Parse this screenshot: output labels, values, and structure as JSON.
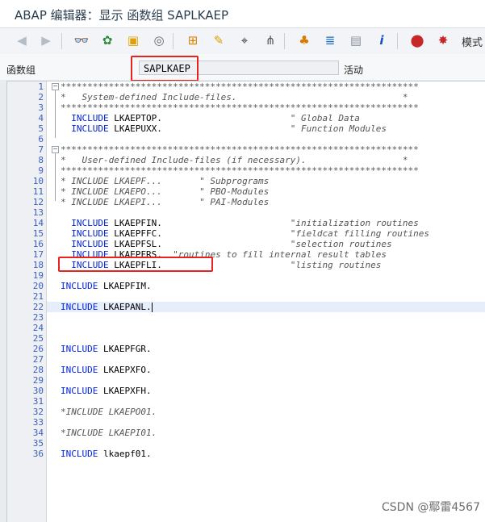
{
  "title": "ABAP 编辑器：显示 函数组 SAPLKAEP",
  "toolbar": {
    "icons": [
      "back-arrow-icon",
      "forward-arrow-icon",
      "glasses-icon",
      "object-list-icon",
      "shared-object-icon",
      "where-used-icon",
      "hierarchy-icon",
      "magic-wand-icon",
      "pattern-icon",
      "pretty-printer-icon",
      "org-chart-icon",
      "stack-icon",
      "layout-icon",
      "info-icon",
      "debug-session-icon",
      "external-breakpoint-icon"
    ],
    "mode_label": "模式"
  },
  "field": {
    "label": "函数组",
    "value": "SAPLKAEP",
    "status": "活动"
  },
  "lines": [
    {
      "n": "1",
      "t": "*******************************************************************",
      "c": "cm",
      "fold": "start"
    },
    {
      "n": "2",
      "t": "*   System-defined Include-files.                               *",
      "c": "cm"
    },
    {
      "n": "3",
      "t": "*******************************************************************",
      "c": "cm"
    },
    {
      "n": "4",
      "segs": [
        {
          "t": "  ",
          "c": ""
        },
        {
          "t": "INCLUDE",
          "c": "kw"
        },
        {
          "t": " LKAEPTOP.                        ",
          "c": ""
        },
        {
          "t": "\" Global Data",
          "c": "cm"
        }
      ]
    },
    {
      "n": "5",
      "segs": [
        {
          "t": "  ",
          "c": ""
        },
        {
          "t": "INCLUDE",
          "c": "kw"
        },
        {
          "t": " LKAEPUXX.                        ",
          "c": ""
        },
        {
          "t": "\" Function Modules",
          "c": "cm"
        }
      ]
    },
    {
      "n": "6",
      "t": "",
      "c": ""
    },
    {
      "n": "7",
      "t": "*******************************************************************",
      "c": "cm",
      "fold": "start"
    },
    {
      "n": "8",
      "t": "*   User-defined Include-files (if necessary).                  *",
      "c": "cm"
    },
    {
      "n": "9",
      "t": "*******************************************************************",
      "c": "cm"
    },
    {
      "n": "10",
      "t": "* INCLUDE LKAEPF...       \" Subprograms",
      "c": "cm"
    },
    {
      "n": "11",
      "t": "* INCLUDE LKAEPO...       \" PBO-Modules",
      "c": "cm"
    },
    {
      "n": "12",
      "t": "* INCLUDE LKAEPI...       \" PAI-Modules",
      "c": "cm"
    },
    {
      "n": "13",
      "t": "",
      "c": ""
    },
    {
      "n": "14",
      "segs": [
        {
          "t": "  ",
          "c": ""
        },
        {
          "t": "INCLUDE",
          "c": "kw"
        },
        {
          "t": " LKAEPFIN.                        ",
          "c": ""
        },
        {
          "t": "\"initialization routines",
          "c": "cm"
        }
      ]
    },
    {
      "n": "15",
      "segs": [
        {
          "t": "  ",
          "c": ""
        },
        {
          "t": "INCLUDE",
          "c": "kw"
        },
        {
          "t": " LKAEPFFC.                        ",
          "c": ""
        },
        {
          "t": "\"fieldcat filling routines",
          "c": "cm"
        }
      ]
    },
    {
      "n": "16",
      "segs": [
        {
          "t": "  ",
          "c": ""
        },
        {
          "t": "INCLUDE",
          "c": "kw"
        },
        {
          "t": " LKAEPFSL.                        ",
          "c": ""
        },
        {
          "t": "\"selection routines",
          "c": "cm"
        }
      ]
    },
    {
      "n": "17",
      "segs": [
        {
          "t": "  ",
          "c": ""
        },
        {
          "t": "INCLUDE",
          "c": "kw"
        },
        {
          "t": " LKAEPFRS.  ",
          "c": ""
        },
        {
          "t": "\"routines to fill internal result tables",
          "c": "cm"
        }
      ]
    },
    {
      "n": "18",
      "segs": [
        {
          "t": "  ",
          "c": ""
        },
        {
          "t": "INCLUDE",
          "c": "kw"
        },
        {
          "t": " LKAEPFLI.                        ",
          "c": ""
        },
        {
          "t": "\"listing routines",
          "c": "cm"
        }
      ]
    },
    {
      "n": "19",
      "t": "",
      "c": ""
    },
    {
      "n": "20",
      "segs": [
        {
          "t": "INCLUDE",
          "c": "kw"
        },
        {
          "t": " LKAEPFIM.",
          "c": ""
        }
      ]
    },
    {
      "n": "21",
      "t": "",
      "c": ""
    },
    {
      "n": "22",
      "segs": [
        {
          "t": "INCLUDE",
          "c": "kw"
        },
        {
          "t": " LKAEPANL.",
          "c": ""
        }
      ],
      "current": true
    },
    {
      "n": "23",
      "t": "",
      "c": ""
    },
    {
      "n": "24",
      "t": "",
      "c": ""
    },
    {
      "n": "25",
      "t": "",
      "c": ""
    },
    {
      "n": "26",
      "segs": [
        {
          "t": "INCLUDE",
          "c": "kw"
        },
        {
          "t": " LKAEPFGR.",
          "c": ""
        }
      ]
    },
    {
      "n": "27",
      "t": "",
      "c": ""
    },
    {
      "n": "28",
      "segs": [
        {
          "t": "INCLUDE",
          "c": "kw"
        },
        {
          "t": " LKAEPXFO.",
          "c": ""
        }
      ]
    },
    {
      "n": "29",
      "t": "",
      "c": ""
    },
    {
      "n": "30",
      "segs": [
        {
          "t": "INCLUDE",
          "c": "kw"
        },
        {
          "t": " LKAEPXFH.",
          "c": ""
        }
      ]
    },
    {
      "n": "31",
      "t": "",
      "c": ""
    },
    {
      "n": "32",
      "t": "*INCLUDE LKAEPO01.",
      "c": "cm"
    },
    {
      "n": "33",
      "t": "",
      "c": ""
    },
    {
      "n": "34",
      "t": "*INCLUDE LKAEPI01.",
      "c": "cm"
    },
    {
      "n": "35",
      "t": "",
      "c": ""
    },
    {
      "n": "36",
      "segs": [
        {
          "t": "INCLUDE",
          "c": "kw"
        },
        {
          "t": " lkaepf01.",
          "c": ""
        }
      ]
    }
  ],
  "watermark": "CSDN @鄢雷4567",
  "colors": {
    "keyword": "#0022d9",
    "comment": "#555555",
    "line_number": "#3a5fbf",
    "highlight": "#e8231b"
  }
}
